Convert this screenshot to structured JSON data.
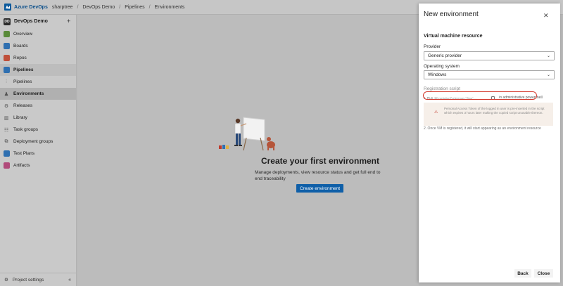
{
  "topbar": {
    "brand": "Azure DevOps",
    "org": "sharptree",
    "project": "DevOps Demo",
    "section": "Pipelines",
    "page": "Environments",
    "separator": "/"
  },
  "sidebar": {
    "project_initials": "DD",
    "project_name": "DevOps Demo",
    "add_symbol": "+",
    "items": [
      {
        "label": "Overview",
        "icon": "overview-icon",
        "color": "#5a8a3a"
      },
      {
        "label": "Boards",
        "icon": "boards-icon",
        "color": "#2f6fb0"
      },
      {
        "label": "Repos",
        "icon": "repos-icon",
        "color": "#c0503a"
      },
      {
        "label": "Pipelines",
        "icon": "pipelines-icon",
        "color": "#2f6fb0"
      },
      {
        "label": "Pipelines",
        "icon": "pipelines-sub-icon"
      },
      {
        "label": "Environments",
        "icon": "environments-icon"
      },
      {
        "label": "Releases",
        "icon": "releases-icon"
      },
      {
        "label": "Library",
        "icon": "library-icon"
      },
      {
        "label": "Task groups",
        "icon": "task-groups-icon"
      },
      {
        "label": "Deployment groups",
        "icon": "deployment-groups-icon"
      },
      {
        "label": "Test Plans",
        "icon": "test-plans-icon",
        "color": "#2f6fb0"
      },
      {
        "label": "Artifacts",
        "icon": "artifacts-icon",
        "color": "#b04a7a"
      }
    ],
    "settings_label": "Project settings",
    "collapse_symbol": "«"
  },
  "main": {
    "empty_title": "Create your first environment",
    "empty_subtitle": "Manage deployments, view resource status and get full end to end traceability",
    "create_button": "Create environment"
  },
  "panel": {
    "title": "New environment",
    "close_symbol": "✕",
    "section_title": "Virtual machine resource",
    "provider_label": "Provider",
    "provider_value": "Generic provider",
    "os_label": "Operating system",
    "os_value": "Windows",
    "registration_label": "Registration script",
    "step1_prefix": "1. Run",
    "step1_command": "$ErrorActionPreference=\"Stop\";...",
    "step1_suffix": "in administrative powershell",
    "warning_text": "Personal Access Token of the logged in user is pre-inserted in the script which expires 3 hours later making the copied script unusable thereon.",
    "step2": "2. Once VM is registered, it will start appearing as an environment resource",
    "back_button": "Back",
    "close_button": "Close",
    "caret_symbol": "⌄",
    "highlight_color": "#d43b2f"
  }
}
